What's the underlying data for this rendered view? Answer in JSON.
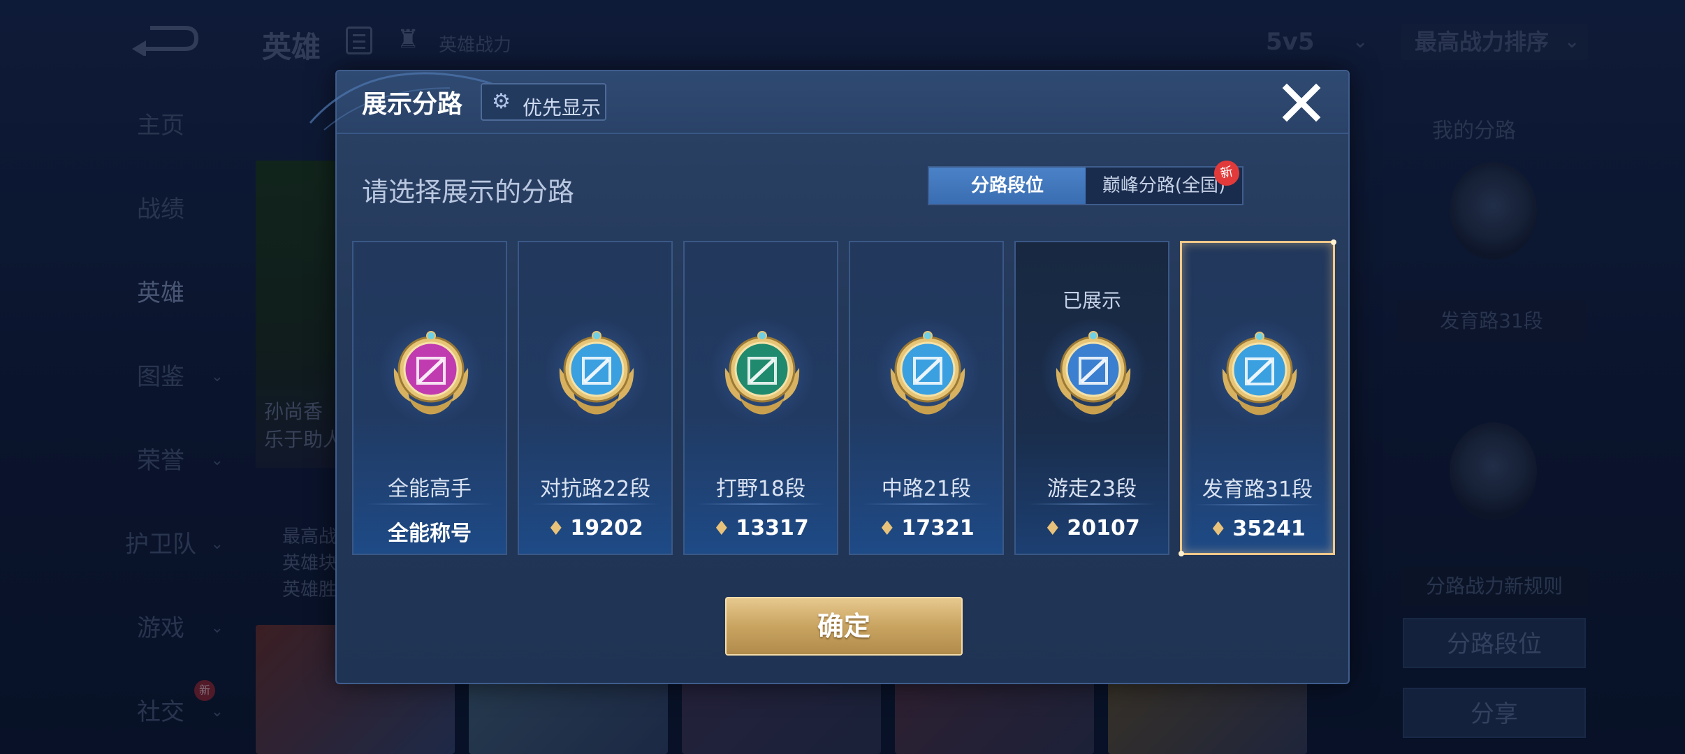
{
  "background": {
    "title": "英雄",
    "power_label": "英雄战力",
    "mode": "5v5",
    "sort": "最高战力排序",
    "nav": [
      {
        "label": "主页"
      },
      {
        "label": "战绩"
      },
      {
        "label": "英雄"
      },
      {
        "label": "图鉴"
      },
      {
        "label": "荣誉"
      },
      {
        "label": "护卫队"
      },
      {
        "label": "游戏"
      },
      {
        "label": "社交",
        "badge": "新"
      }
    ],
    "hero_card_lines": [
      "孙尚香",
      "乐于助人"
    ],
    "hero_info_lines": [
      "最高战",
      "英雄块",
      "英雄胜"
    ],
    "right_panel": {
      "title": "我的分路",
      "badge_label": "发育路31段",
      "rule": "分路战力新规则",
      "btn_lane": "分路段位",
      "btn_share": "分享"
    }
  },
  "modal": {
    "title": "展示分路",
    "priority_label": "优先显示",
    "subtitle": "请选择展示的分路",
    "tabs": {
      "active": "分路段位",
      "inactive": "巅峰分路(全国)",
      "new_badge": "新"
    },
    "lanes": [
      {
        "name": "全能高手",
        "score": "全能称号",
        "icon": "all-round-badge-icon",
        "color": "#c13bb0"
      },
      {
        "name": "对抗路22段",
        "score": "19202",
        "icon": "clash-lane-badge-icon",
        "color": "#3aa0e0"
      },
      {
        "name": "打野18段",
        "score": "13317",
        "icon": "jungle-dragon-badge-icon",
        "color": "#1f8a6d"
      },
      {
        "name": "中路21段",
        "score": "17321",
        "icon": "mid-lane-badge-icon",
        "color": "#3aa0e0"
      },
      {
        "name": "游走23段",
        "score": "20107",
        "icon": "roam-wings-badge-icon",
        "color": "#3a7fd0",
        "status": "已展示"
      },
      {
        "name": "发育路31段",
        "score": "35241",
        "icon": "farm-lane-badge-icon",
        "color": "#3aa0e0",
        "selected": true
      }
    ],
    "confirm": "确定"
  }
}
